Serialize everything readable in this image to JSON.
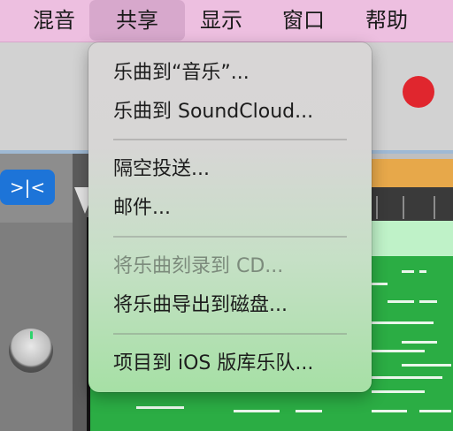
{
  "menubar": {
    "items": [
      "混音",
      "共享",
      "显示",
      "窗口",
      "帮助"
    ],
    "active_index": 1
  },
  "share_menu": {
    "items": [
      {
        "label": "乐曲到“音乐”...",
        "enabled": true
      },
      {
        "label": "乐曲到 SoundCloud...",
        "enabled": true
      },
      {
        "label": "隔空投送...",
        "enabled": true
      },
      {
        "label": "邮件...",
        "enabled": true
      },
      {
        "label": "将乐曲刻录到 CD...",
        "enabled": false
      },
      {
        "label": "将乐曲导出到磁盘...",
        "enabled": true
      },
      {
        "label": "项目到 iOS 版库乐队...",
        "enabled": true
      }
    ]
  },
  "background_app": {
    "smart_controls_icon": "smart-controls-icon",
    "record_color": "#e0262e",
    "region_color": "#2bad44",
    "ruler_color": "#e7a84a"
  }
}
